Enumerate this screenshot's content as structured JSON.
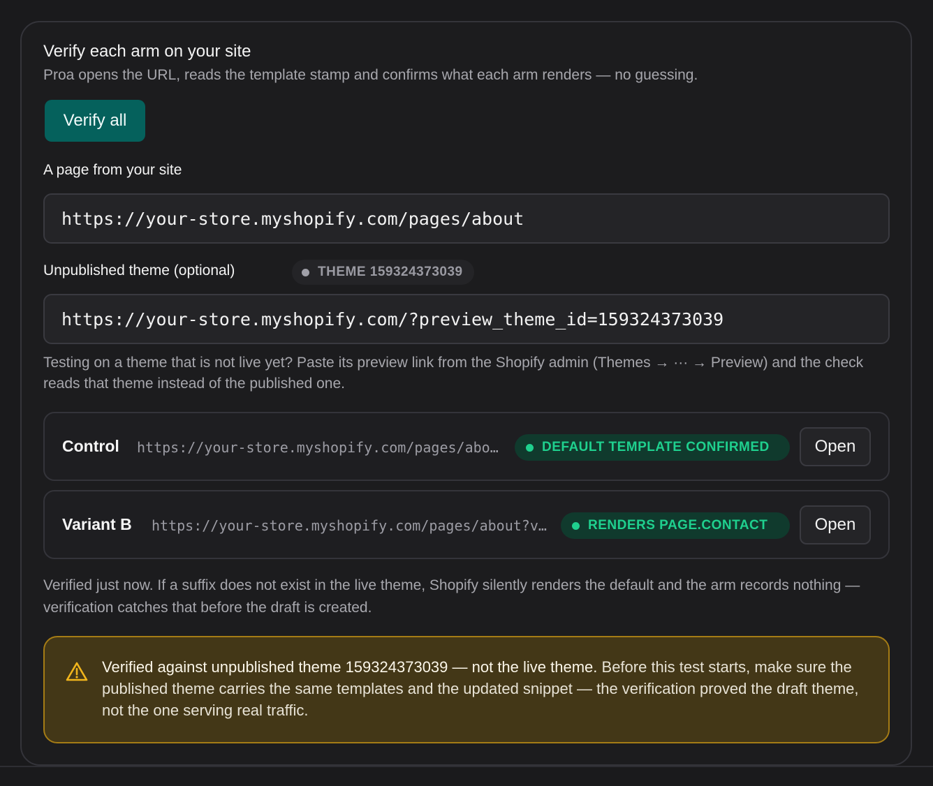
{
  "header": {
    "title": "Verify each arm on your site",
    "subtitle": "Proa opens the URL, reads the template stamp and confirms what each arm renders — no guessing.",
    "verify_all_label": "Verify all"
  },
  "page_field": {
    "label": "A page from your site",
    "value": "https://your-store.myshopify.com/pages/about"
  },
  "theme_field": {
    "label": "Unpublished theme (optional)",
    "badge": "THEME 159324373039",
    "value": "https://your-store.myshopify.com/?preview_theme_id=159324373039",
    "help": "Testing on a theme that is not live yet? Paste its preview link from the Shopify admin (Themes → ··· → Preview) and the check reads that theme instead of the published one."
  },
  "arms": [
    {
      "name": "Control",
      "url": "https://your-store.myshopify.com/pages/about",
      "status": "DEFAULT TEMPLATE CONFIRMED",
      "open_label": "Open"
    },
    {
      "name": "Variant B",
      "url": "https://your-store.myshopify.com/pages/about?view=contact",
      "status": "RENDERS PAGE.CONTACT",
      "open_label": "Open"
    }
  ],
  "note": "Verified just now. If a suffix does not exist in the live theme, Shopify silently renders the default and the arm records nothing — verification catches that before the draft is created.",
  "warning": {
    "icon": "warning-triangle-icon",
    "strong": "Verified against unpublished theme 159324373039 — not the live theme.",
    "body": " Before this test starts, make sure the published theme carries the same templates and the updated snippet — the verification proved the draft theme, not the one serving real traffic."
  },
  "colors": {
    "accent_button": "#05615c",
    "status_green": "#1fd08e",
    "warning_border": "#a57c15",
    "warning_bg": "#433717"
  }
}
